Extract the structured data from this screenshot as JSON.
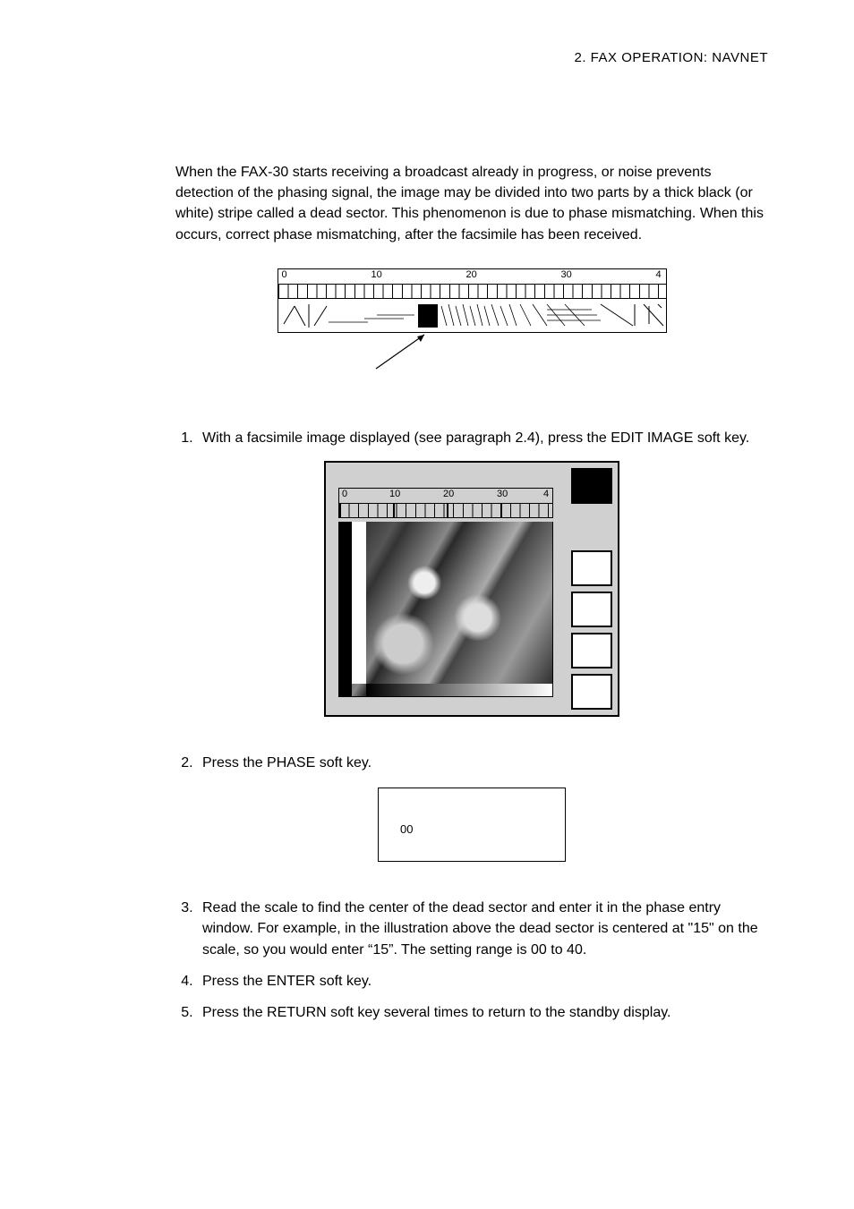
{
  "header": {
    "chapter": "2.  FAX  OPERATION:  NAVNET"
  },
  "intro": "When the FAX-30 starts receiving a broadcast already in progress, or noise prevents detection of the phasing signal, the image may be divided into two parts by a thick black (or white) stripe called a dead sector. This phenomenon is due to phase mismatching. When this occurs, correct phase mismatching, after the facsimile has been received.",
  "ruler": {
    "n0": "0",
    "n10": "10",
    "n20": "20",
    "n30": "30",
    "n40": "4"
  },
  "steps": {
    "s1": "With a facsimile image displayed (see paragraph 2.4), press the EDIT IMAGE soft key.",
    "s2": "Press the PHASE soft key.",
    "s3": "Read the scale to find the center of the dead sector and enter it in the phase entry window. For example, in the illustration above the dead sector is centered at \"15\" on the scale, so you would enter “15”. The setting range is 00 to 40.",
    "s4": "Press the ENTER soft key.",
    "s5": "Press the RETURN soft key several times to return to the standby display."
  },
  "phase_window": {
    "value": "00"
  }
}
